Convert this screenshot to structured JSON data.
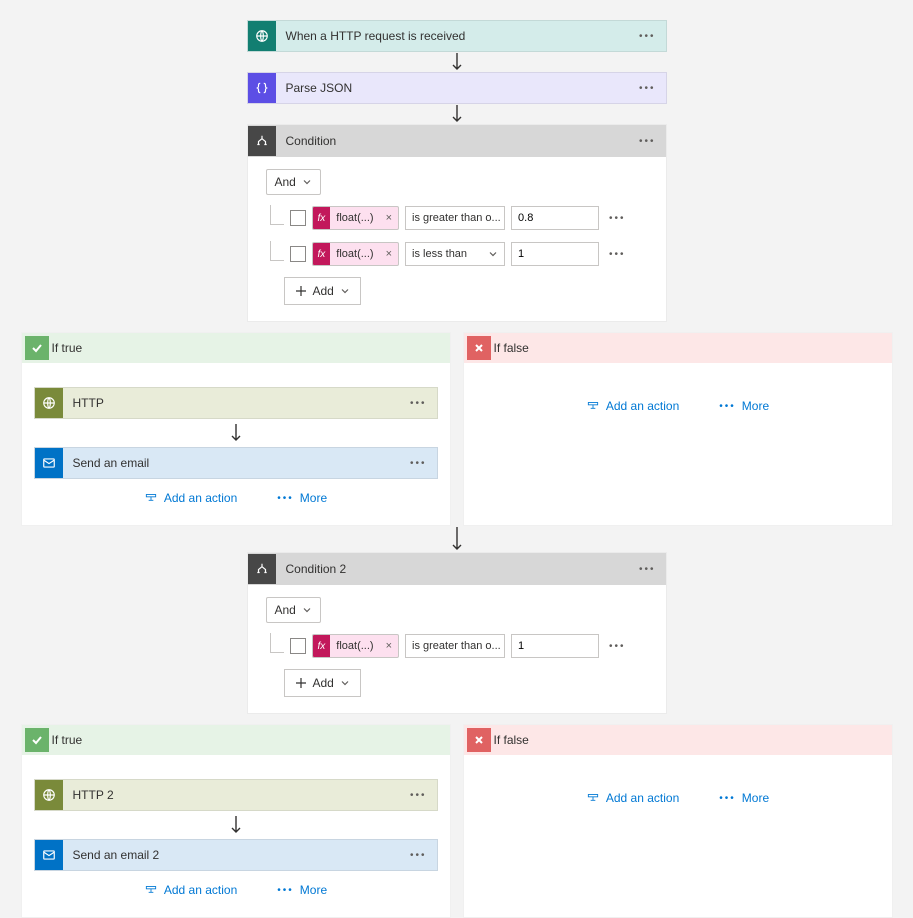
{
  "trigger": {
    "title": "When a HTTP request is received"
  },
  "parse": {
    "title": "Parse JSON"
  },
  "condition1": {
    "title": "Condition",
    "group": "And",
    "rows": [
      {
        "fx": "float(...)",
        "op": "is greater than o...",
        "val": "0.8"
      },
      {
        "fx": "float(...)",
        "op": "is less than",
        "val": "1"
      }
    ],
    "add_label": "Add",
    "true_label": "If true",
    "false_label": "If false",
    "true_actions": [
      {
        "kind": "http",
        "title": "HTTP"
      },
      {
        "kind": "email",
        "title": "Send an email"
      }
    ]
  },
  "condition2": {
    "title": "Condition 2",
    "group": "And",
    "rows": [
      {
        "fx": "float(...)",
        "op": "is greater than o...",
        "val": "1"
      }
    ],
    "add_label": "Add",
    "true_label": "If true",
    "false_label": "If false",
    "true_actions": [
      {
        "kind": "http",
        "title": "HTTP 2"
      },
      {
        "kind": "email",
        "title": "Send an email 2"
      }
    ]
  },
  "footer": {
    "add_action": "Add an action",
    "more": "More"
  }
}
